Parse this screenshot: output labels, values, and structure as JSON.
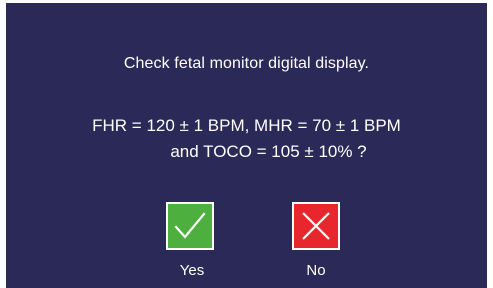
{
  "dialog": {
    "prompt": "Check fetal monitor digital display.",
    "question_line1": "FHR = 120 ± 1 BPM, MHR = 70 ± 1 BPM",
    "question_line2": "and TOCO = 105 ± 10% ?",
    "background_color": "#2b2957"
  },
  "buttons": {
    "yes": {
      "label": "Yes",
      "icon": "check-icon",
      "color": "#4caf3e"
    },
    "no": {
      "label": "No",
      "icon": "x-icon",
      "color": "#e8262d"
    }
  }
}
